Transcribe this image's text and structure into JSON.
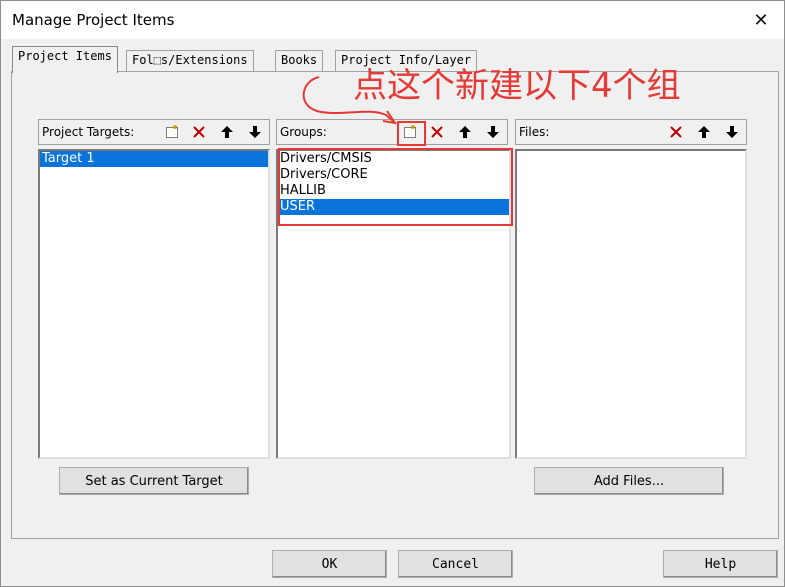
{
  "window": {
    "title": "Manage Project Items",
    "close_glyph": "✕"
  },
  "tabs": [
    {
      "label": "Project Items"
    },
    {
      "label": "Fol⬚s/Extensions"
    },
    {
      "label": "Books"
    },
    {
      "label": "Project Info/Layer"
    }
  ],
  "targets": {
    "label": "Project Targets:",
    "items": [
      "Target 1"
    ],
    "selected_index": 0
  },
  "groups": {
    "label": "Groups:",
    "items": [
      "Drivers/CMSIS",
      "Drivers/CORE",
      "HALLIB",
      "USER"
    ],
    "selected_index": 3
  },
  "files": {
    "label": "Files:",
    "items": []
  },
  "buttons": {
    "set_current": "Set as Current Target",
    "add_files": "Add Files...",
    "ok": "OK",
    "cancel": "Cancel",
    "help": "Help"
  },
  "annotation": {
    "text": "点这个新建以下4个组",
    "color": "#e53935"
  },
  "colors": {
    "selection": "#0a74da",
    "delete_red": "#c00000"
  }
}
